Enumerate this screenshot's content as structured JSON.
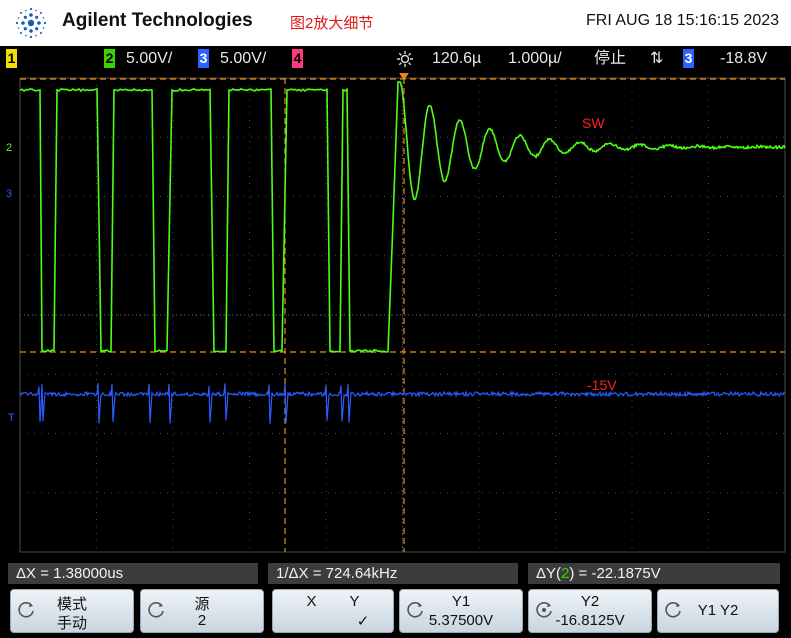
{
  "header": {
    "brand": "Agilent Technologies",
    "note": "图2放大细节",
    "datetime": "FRI AUG 18 15:16:15 2023"
  },
  "status": {
    "ch1": "1",
    "ch2": "2",
    "ch2_scale": "5.00V/",
    "ch3": "3",
    "ch3_scale": "5.00V/",
    "ch4": "4",
    "timebase": "120.6µ",
    "time_div": "1.000µ/",
    "run_state": "停止",
    "trigger_icon": "⇅",
    "trigger_ch": "3",
    "trigger_level": "-18.8V",
    "colors": {
      "ch1": "#f0e000",
      "ch2": "#39d300",
      "ch3": "#2d62ff",
      "ch4": "#ff3a7a"
    }
  },
  "screen": {
    "label_sw": "SW",
    "label_15v": "-15V",
    "marker_ch2": "2",
    "marker_ch3": "3",
    "marker_trigger": "T",
    "colors": {
      "ch2_trace": "#4cff17",
      "ch3_trace": "#2a5cff",
      "cursor": "#e8891a",
      "grid": "#4a4a4a",
      "labels": "#ff2020"
    }
  },
  "measurements": {
    "delta_x": "ΔX = 1.38000us",
    "inv_delta_x": "1/ΔX = 724.64kHz",
    "delta_y_prefix": "ΔY(",
    "delta_y_ch": "2",
    "delta_y_suffix": ") = -22.1875V"
  },
  "softkeys": [
    {
      "line1": "模式",
      "line2": "手动",
      "icon": "knob-icon"
    },
    {
      "line1": "源",
      "line2": "2",
      "icon": "knob-icon"
    },
    {
      "line1": "X        Y",
      "line2": "✓"
    },
    {
      "line1": "Y1",
      "line2": "5.37500V",
      "icon": "knob-icon"
    },
    {
      "line1": "Y2",
      "line2": "-16.8125V",
      "icon": "knob-push-icon"
    },
    {
      "line1": "Y1 Y2",
      "line2": "",
      "icon": "knob-icon"
    }
  ]
}
